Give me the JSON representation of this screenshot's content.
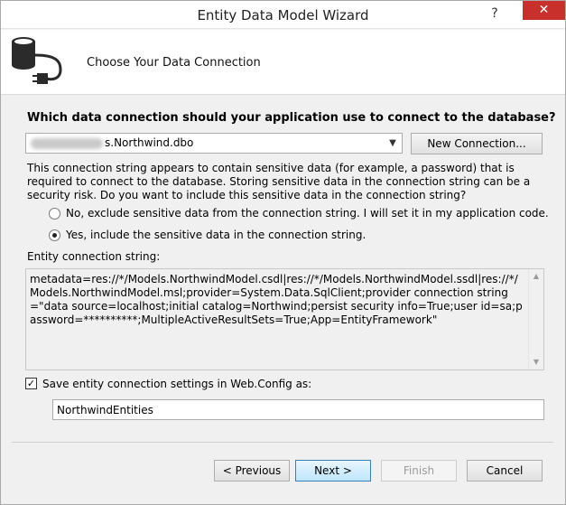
{
  "window": {
    "title": "Entity Data Model Wizard",
    "help_glyph": "?",
    "close_glyph": "✕"
  },
  "header": {
    "icon": "database-plug-icon",
    "title": "Choose Your Data Connection"
  },
  "connection": {
    "question": "Which data connection should your application use to connect to the database?",
    "selected_value": "s.Northwind.dbo",
    "new_connection_label": "New Connection..."
  },
  "sensitive": {
    "warning": "This connection string appears to contain sensitive data (for example, a password) that is required to connect to the database. Storing sensitive data in the connection string can be a security risk. Do you want to include this sensitive data in the connection string?",
    "options": [
      {
        "label": "No, exclude sensitive data from the connection string. I will set it in my application code.",
        "checked": false
      },
      {
        "label": "Yes, include the sensitive data in the connection string.",
        "checked": true
      }
    ]
  },
  "entity_connection": {
    "label": "Entity connection string:",
    "value": "metadata=res://*/Models.NorthwindModel.csdl|res://*/Models.NorthwindModel.ssdl|res://*/Models.NorthwindModel.msl;provider=System.Data.SqlClient;provider connection string=\"data source=localhost;initial catalog=Northwind;persist security info=True;user id=sa;password=**********;MultipleActiveResultSets=True;App=EntityFramework\""
  },
  "save_settings": {
    "checked": true,
    "label": "Save entity connection settings in Web.Config as:",
    "name_value": "NorthwindEntities"
  },
  "footer": {
    "previous_label": "< Previous",
    "next_label": "Next >",
    "finish_label": "Finish",
    "cancel_label": "Cancel"
  }
}
